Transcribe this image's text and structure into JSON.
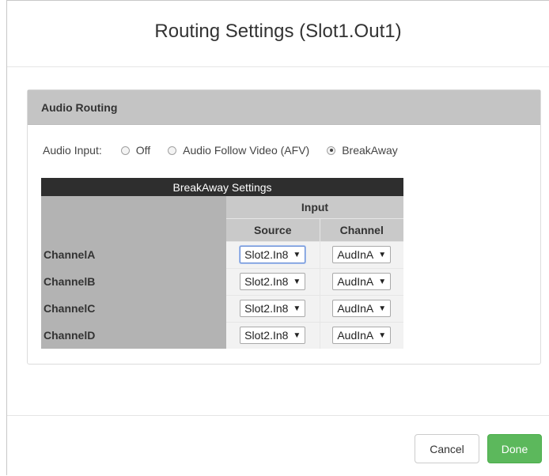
{
  "modal": {
    "title": "Routing Settings (Slot1.Out1)"
  },
  "panel": {
    "heading": "Audio Routing",
    "audio_input": {
      "label": "Audio Input:",
      "options": [
        {
          "label": "Off",
          "checked": false
        },
        {
          "label": "Audio Follow Video (AFV)",
          "checked": false
        },
        {
          "label": "BreakAway",
          "checked": true
        }
      ]
    },
    "breakaway": {
      "title": "BreakAway Settings",
      "input_header": "Input",
      "source_header": "Source",
      "channel_header": "Channel",
      "rows": [
        {
          "label": "ChannelA",
          "source": "Slot2.In8",
          "channel": "AudInA"
        },
        {
          "label": "ChannelB",
          "source": "Slot2.In8",
          "channel": "AudInA"
        },
        {
          "label": "ChannelC",
          "source": "Slot2.In8",
          "channel": "AudInA"
        },
        {
          "label": "ChannelD",
          "source": "Slot2.In8",
          "channel": "AudInA"
        }
      ]
    }
  },
  "footer": {
    "cancel_label": "Cancel",
    "done_label": "Done"
  },
  "colors": {
    "done_button": "#5cb85c",
    "panel_heading": "#c4c4c4",
    "table_title": "#2e2e2e"
  }
}
